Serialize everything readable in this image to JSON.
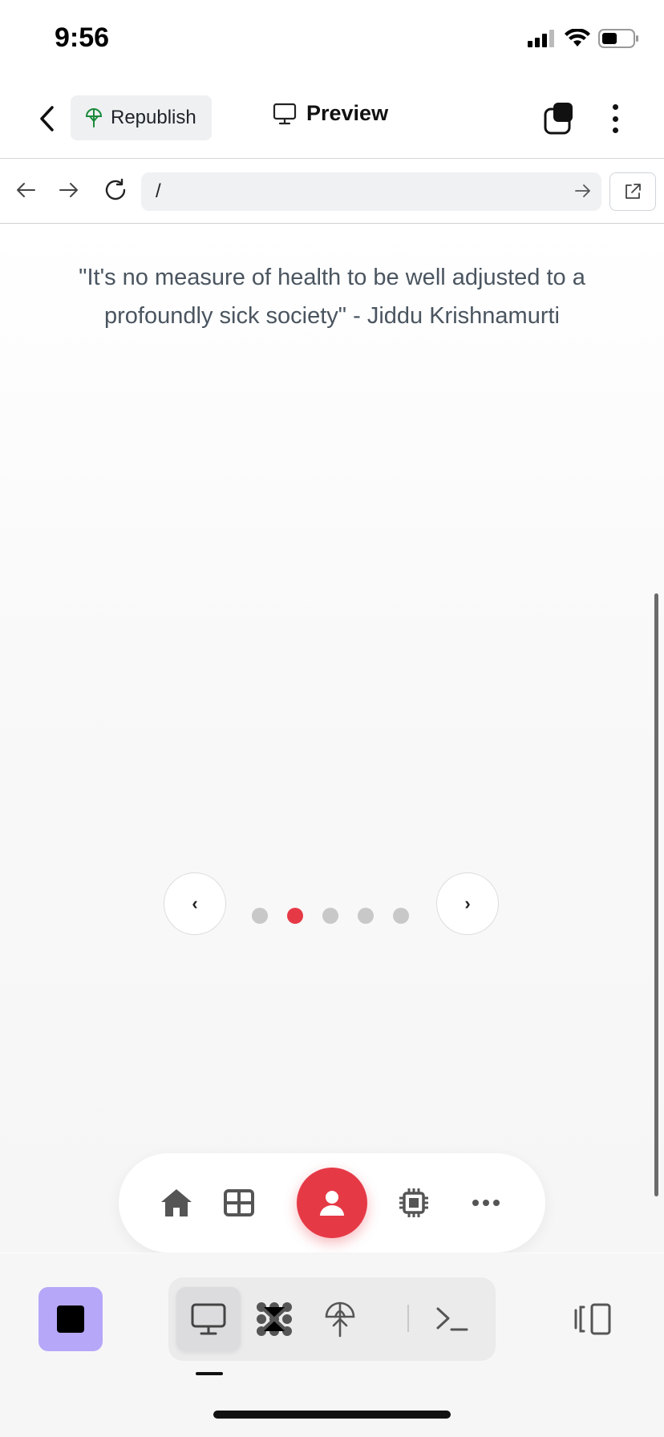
{
  "status_bar": {
    "time": "9:56",
    "icons": [
      "signal-icon",
      "wifi-icon",
      "battery-icon"
    ]
  },
  "header": {
    "back_icon": "chevron-left-icon",
    "republish_label": "Republish",
    "republish_icon": "deploy-icon",
    "preview_label": "Preview",
    "preview_icon": "monitor-icon",
    "layers_icon": "layers-icon",
    "menu_icon": "kebab-icon"
  },
  "browser": {
    "back_icon": "arrow-left-icon",
    "forward_icon": "arrow-right-icon",
    "reload_icon": "reload-icon",
    "url": "/",
    "go_icon": "arrow-right-icon",
    "open_external_icon": "external-link-icon"
  },
  "page": {
    "quote": "\"It's no measure of health to be well adjusted to a profoundly sick society\" - Jiddu Krishnamurti",
    "carousel": {
      "prev_label": "‹",
      "next_label": "›",
      "total_slides": 5,
      "active_slide": 2
    },
    "bottom_nav": {
      "items": [
        "home-icon",
        "grid-icon",
        "profile-icon",
        "chip-icon",
        "more-icon"
      ],
      "active": "profile-icon"
    },
    "accent_color": "#e63946"
  },
  "toolbar": {
    "stop_icon": "stop-icon",
    "stop_color": "#b6a7f8",
    "tools": [
      "monitor-icon",
      "nodes-icon",
      "deploy-icon",
      "terminal-icon"
    ],
    "active_tool": "monitor-icon",
    "panel_icon": "panel-toggle-icon"
  }
}
